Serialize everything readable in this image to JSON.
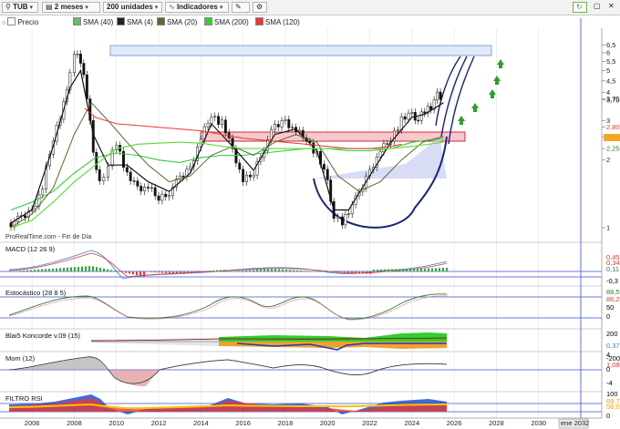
{
  "toolbar": {
    "ticker": "TUB",
    "timeframe": "2 meses",
    "units": "200 unidades",
    "indicators": "Indicadores"
  },
  "legend": [
    {
      "label": "Precio",
      "color": "#111111"
    },
    {
      "label": "SMA (40)",
      "color": "#2e7d32"
    },
    {
      "label": "SMA (4)",
      "color": "#111111"
    },
    {
      "label": "SMA (20)",
      "color": "#556b2f"
    },
    {
      "label": "SMA (200)",
      "color": "#33cc33"
    },
    {
      "label": "SMA (120)",
      "color": "#e53935"
    }
  ],
  "watermark": "ProRealTime.com - Fin de Día",
  "panels": {
    "macd": {
      "label": "MACD (12 26 9)",
      "ticks": [
        "0,45",
        "0,34",
        "0,11",
        "-0,3"
      ],
      "tick_colors": [
        "#e53935",
        "#e53935",
        "#2e7d32",
        "#000000"
      ]
    },
    "stoch": {
      "label": "Estocástico (28 8 5)",
      "ticks": [
        "88,5",
        "86,2",
        "50",
        "0"
      ],
      "tick_colors": [
        "#2e7d32",
        "#e53935",
        "#000000",
        "#000000"
      ]
    },
    "blai": {
      "label": "Blai5 Koncorde v.09 (15)",
      "ticks": [
        "200",
        "0,37",
        "-200"
      ],
      "tick_colors": [
        "#000000",
        "#3a7bd5",
        "#000000"
      ]
    },
    "mom": {
      "label": "Mom (12)",
      "ticks": [
        "4",
        "1,08",
        "0",
        "-4"
      ],
      "tick_colors": [
        "#000000",
        "#e53935",
        "#000000",
        "#000000"
      ]
    },
    "rsi": {
      "label": "FILTRO RSI",
      "ticks": [
        "100",
        "69,7",
        "58,0",
        "0"
      ],
      "tick_colors": [
        "#000000",
        "#e8a000",
        "#e8a000",
        "#000000"
      ]
    }
  },
  "chart_data": {
    "type": "line",
    "title": "TUB",
    "y_scale": "log",
    "y_ticks": [
      "6,5",
      "6",
      "5,5",
      "5",
      "4,5",
      "4",
      "3,75",
      "3,70",
      "3",
      "2,80",
      "2,53",
      "2,25",
      "2",
      "1"
    ],
    "x_ticks": [
      "2006",
      "2008",
      "2010",
      "2012",
      "2014",
      "2016",
      "2018",
      "2020",
      "2022",
      "2024",
      "2026",
      "2028",
      "2030",
      "ene 2032"
    ],
    "x_range": [
      2004.8,
      2032.0
    ],
    "series": [
      {
        "name": "Precio",
        "x": [
          2005.0,
          2005.5,
          2006.0,
          2006.5,
          2007.0,
          2007.5,
          2007.8,
          2008.0,
          2008.3,
          2008.6,
          2008.9,
          2009.2,
          2009.6,
          2010.0,
          2010.5,
          2011.0,
          2011.5,
          2012.0,
          2012.5,
          2013.0,
          2013.5,
          2014.0,
          2014.5,
          2015.0,
          2015.5,
          2016.0,
          2016.5,
          2017.0,
          2017.5,
          2018.0,
          2018.5,
          2019.0,
          2019.5,
          2020.0,
          2020.3,
          2020.7,
          2021.0,
          2021.5,
          2022.0,
          2022.5,
          2023.0,
          2023.5,
          2024.0,
          2024.3,
          2024.6,
          2024.9,
          2025.2,
          2025.5
        ],
        "values": [
          1.05,
          1.1,
          1.2,
          1.5,
          2.5,
          3.5,
          4.8,
          5.9,
          5.5,
          3.9,
          2.1,
          1.6,
          1.9,
          2.4,
          1.7,
          1.5,
          1.5,
          1.35,
          1.45,
          1.65,
          1.85,
          2.5,
          3.2,
          2.9,
          2.2,
          1.6,
          1.75,
          2.3,
          2.8,
          3.0,
          2.7,
          2.5,
          2.1,
          1.6,
          1.1,
          1.05,
          1.2,
          1.4,
          1.8,
          2.2,
          2.5,
          3.0,
          3.2,
          3.0,
          3.3,
          3.5,
          3.9,
          3.7
        ]
      },
      {
        "name": "SMA (40)",
        "x": [
          2005.0,
          2006.0,
          2007.0,
          2008.0,
          2009.0,
          2010.0,
          2011.0,
          2012.0,
          2013.0,
          2014.0,
          2015.0,
          2016.0,
          2017.0,
          2018.0,
          2019.0,
          2020.0,
          2021.0,
          2022.0,
          2023.0,
          2024.0,
          2025.5
        ],
        "values": [
          1.2,
          1.3,
          1.45,
          1.75,
          2.05,
          2.15,
          2.1,
          2.0,
          1.95,
          2.05,
          2.1,
          2.1,
          2.15,
          2.2,
          2.25,
          2.25,
          2.2,
          2.2,
          2.25,
          2.4,
          2.5
        ]
      },
      {
        "name": "SMA (4)",
        "x": [
          2005.0,
          2006.0,
          2007.0,
          2007.8,
          2008.3,
          2008.9,
          2009.6,
          2010.5,
          2011.5,
          2012.5,
          2013.5,
          2014.5,
          2015.5,
          2016.5,
          2017.5,
          2018.5,
          2019.5,
          2020.3,
          2021.0,
          2022.0,
          2023.0,
          2024.0,
          2024.6,
          2025.5
        ],
        "values": [
          1.05,
          1.2,
          2.3,
          4.2,
          5.0,
          2.6,
          1.9,
          1.9,
          1.6,
          1.45,
          1.75,
          2.9,
          2.3,
          1.8,
          2.6,
          2.75,
          2.2,
          1.2,
          1.2,
          1.7,
          2.4,
          3.1,
          3.2,
          3.6
        ]
      },
      {
        "name": "SMA (20)",
        "x": [
          2005.0,
          2006.0,
          2007.0,
          2008.0,
          2008.8,
          2009.6,
          2010.5,
          2011.5,
          2012.5,
          2013.5,
          2014.5,
          2015.5,
          2016.5,
          2017.5,
          2018.5,
          2019.5,
          2020.5,
          2021.5,
          2022.5,
          2023.5,
          2024.5,
          2025.5
        ],
        "values": [
          1.0,
          1.15,
          1.5,
          2.6,
          3.6,
          3.0,
          2.4,
          1.9,
          1.6,
          1.7,
          2.1,
          2.3,
          2.1,
          2.4,
          2.6,
          2.4,
          1.7,
          1.45,
          1.6,
          2.0,
          2.4,
          2.55
        ]
      },
      {
        "name": "SMA (200)",
        "x": [
          2005.0,
          2006.0,
          2007.0,
          2008.0,
          2009.0,
          2010.0,
          2011.0,
          2012.0,
          2013.0,
          2014.0,
          2015.0,
          2016.0,
          2017.0,
          2018.0,
          2019.0,
          2020.0,
          2021.0,
          2022.0,
          2023.0,
          2024.0,
          2025.5
        ],
        "values": [
          1.0,
          1.08,
          1.3,
          1.6,
          1.9,
          2.25,
          2.35,
          2.38,
          2.4,
          2.38,
          2.3,
          2.25,
          2.25,
          2.25,
          2.25,
          2.25,
          2.25,
          2.25,
          2.25,
          2.3,
          2.4
        ]
      },
      {
        "name": "SMA (120)",
        "x": [
          2008.5,
          2009.0,
          2010.0,
          2011.0,
          2012.0,
          2013.0,
          2014.0,
          2015.0,
          2016.0,
          2017.0,
          2018.0,
          2019.0,
          2020.0,
          2021.0,
          2022.0,
          2023.0,
          2023.5
        ],
        "values": [
          3.4,
          3.1,
          2.9,
          2.85,
          2.8,
          2.75,
          2.7,
          2.6,
          2.5,
          2.45,
          2.4,
          2.35,
          2.3,
          2.25,
          2.25,
          2.3,
          2.35
        ]
      }
    ]
  }
}
